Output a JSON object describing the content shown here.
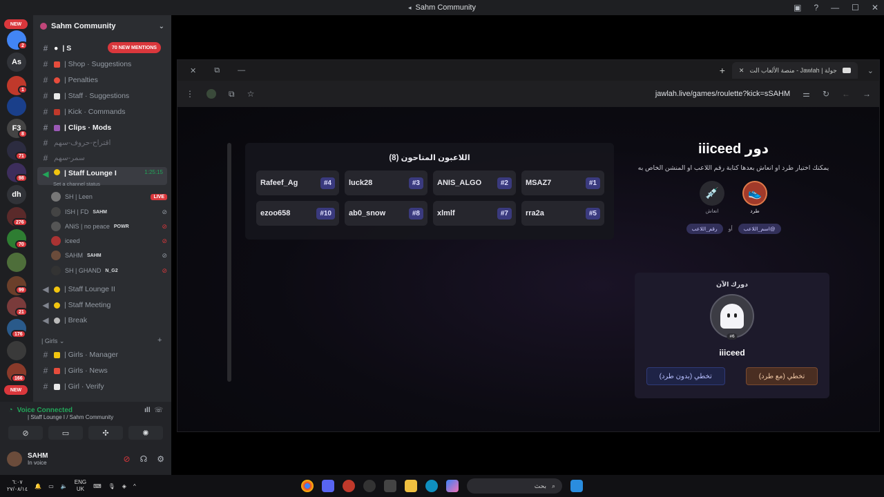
{
  "window": {
    "title": "Sahm Community"
  },
  "rail": {
    "labels": [
      "As",
      "dh",
      "F3"
    ],
    "badges": [
      "2",
      "1",
      "8",
      "71",
      "98",
      "276",
      "70",
      "99",
      "21",
      "176",
      "166"
    ],
    "new_label": "NEW"
  },
  "sidebar": {
    "guild_name": "Sahm Community",
    "new_mentions": "70 NEW MENTIONS",
    "channels": [
      {
        "name": "| Shop · Suggestions"
      },
      {
        "name": "| Penalties"
      },
      {
        "name": "| Staff · Suggestions"
      },
      {
        "name": "| Kick · Commands"
      },
      {
        "name": "| Clips · Mods"
      },
      {
        "name": "اقتراح-حروف-سهم"
      },
      {
        "name": "سمر-سهم"
      }
    ],
    "voice_channel": {
      "name": "| Staff Lounge I",
      "timer": "1:25:15",
      "status": "Set a channel status"
    },
    "voice_users": [
      {
        "name": "SH | Leen",
        "live": "LIVE"
      },
      {
        "name": "ISH | FD",
        "tag": "SAHM"
      },
      {
        "name": "ANiS | no peace",
        "tag": "POWR"
      },
      {
        "name": "iceed"
      },
      {
        "name": "SAHM",
        "tag": "SAHM"
      },
      {
        "name": "SH | GHAND",
        "tag": "N_G2"
      }
    ],
    "more_voice": [
      "| Staff Lounge II",
      "| Staff Meeting",
      "| Break"
    ],
    "category": "| Girls",
    "girls_channels": [
      "| Girls · Manager",
      "| Girls · News",
      "| Girl · Verify"
    ]
  },
  "voice_panel": {
    "status": "Voice Connected",
    "location": "| Staff Lounge I / Sahm Community"
  },
  "user_panel": {
    "name": "SAHM",
    "status": "In voice"
  },
  "browser": {
    "tab_title": "جولة | Jawlah - منصة الألعاب الت",
    "url": "jawlah.live/games/roulette?kick=sSAHM"
  },
  "players": {
    "title": "اللاعبون المتاحون (8)",
    "list": [
      {
        "num": "#1",
        "name": "MSAZ7"
      },
      {
        "num": "#2",
        "name": "ANIS_ALGO"
      },
      {
        "num": "#3",
        "name": "luck28"
      },
      {
        "num": "#4",
        "name": "Rafeef_Ag"
      },
      {
        "num": "#5",
        "name": "rra2a"
      },
      {
        "num": "#7",
        "name": "xlmlf"
      },
      {
        "num": "#8",
        "name": "ab0_snow"
      },
      {
        "num": "#10",
        "name": "ezoo658"
      }
    ]
  },
  "turn": {
    "title": "دور iiiceed",
    "description": "يمكنك اختيار طرد او انعاش بعدها كتابة رقم اللاعب او المنشن الخاص به",
    "mode_kick": "طرد",
    "mode_revive": "انعاش",
    "tag_username": "@اسم_اللاعب",
    "or": "أو",
    "tag_number": "رقم_اللاعب",
    "current_label": "دورك الآن",
    "current_rank": "#6",
    "current_name": "iiiceed",
    "btn_skip_kick": "تخطي (مع طرد)",
    "btn_skip_nokick": "تخطي (بدون طرد)"
  },
  "taskbar": {
    "time": "٦:٠٧",
    "date": "٢٧/٠٨/١٤",
    "lang": "ENG",
    "region": "UK",
    "search_placeholder": "بحث"
  }
}
